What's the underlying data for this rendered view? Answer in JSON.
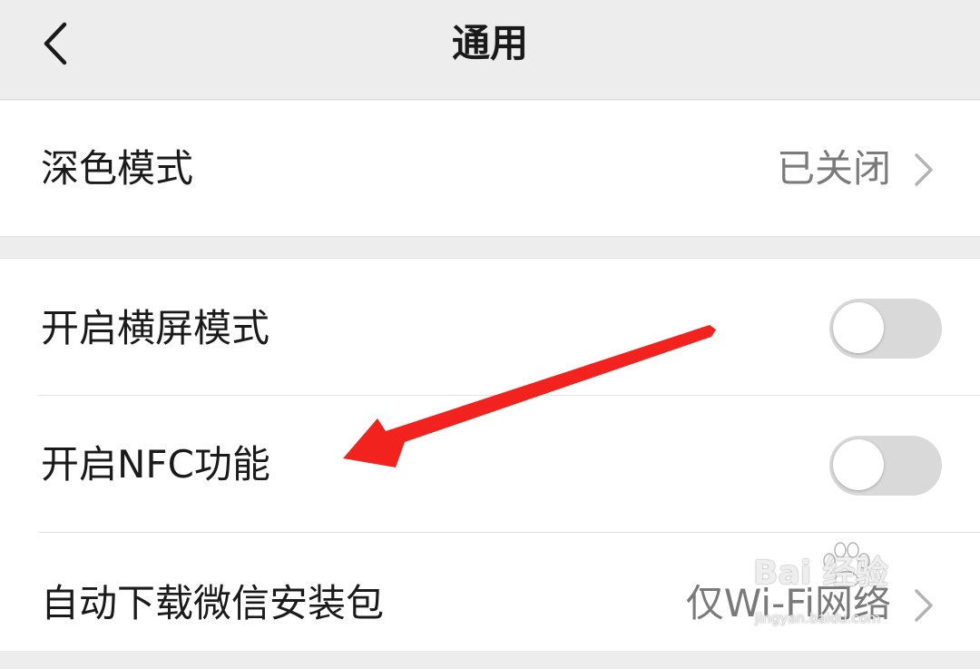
{
  "nav": {
    "title": "通用",
    "back_icon": "chevron-left-icon"
  },
  "settings": {
    "dark_mode": {
      "label": "深色模式",
      "value": "已关闭",
      "icon": "chevron-right-icon"
    },
    "landscape_mode": {
      "label": "开启横屏模式",
      "enabled": false
    },
    "nfc": {
      "label": "开启NFC功能",
      "enabled": false
    },
    "auto_download": {
      "label": "自动下载微信安装包",
      "value": "仅Wi-Fi网络",
      "icon": "chevron-right-icon"
    }
  },
  "annotation": {
    "color": "#f2231f",
    "icon": "red-arrow-icon",
    "points_to": "开启NFC功能"
  },
  "watermark": {
    "main": "Bai 经验",
    "sub": "jingyan.baidu.com"
  },
  "colors": {
    "background": "#ededed",
    "card": "#ffffff",
    "text_primary": "#1a1a1a",
    "text_secondary": "#7a7a7a",
    "toggle_off": "#d9d9d9"
  }
}
